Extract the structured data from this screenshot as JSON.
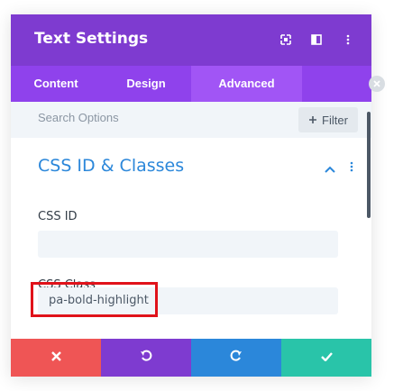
{
  "modal": {
    "title": "Text Settings",
    "header_icons": [
      "expand-icon",
      "split-view-icon",
      "more-vertical-icon"
    ]
  },
  "tabs": [
    {
      "label": "Content",
      "active": false
    },
    {
      "label": "Design",
      "active": false
    },
    {
      "label": "Advanced",
      "active": true
    }
  ],
  "search": {
    "placeholder": "Search Options",
    "filter_label": "Filter",
    "filter_icon": "plus-icon"
  },
  "section": {
    "title": "CSS ID & Classes",
    "collapse_icon": "chevron-up-icon",
    "menu_icon": "more-vertical-icon",
    "fields": [
      {
        "label": "CSS ID",
        "value": ""
      },
      {
        "label": "CSS Class",
        "value": "pa-bold-highlight"
      }
    ]
  },
  "footer": {
    "buttons": [
      {
        "name": "cancel",
        "icon": "close-icon",
        "color": "#ef5555"
      },
      {
        "name": "undo",
        "icon": "undo-icon",
        "color": "#7e3bd0"
      },
      {
        "name": "redo",
        "icon": "redo-icon",
        "color": "#2b87da"
      },
      {
        "name": "save",
        "icon": "check-icon",
        "color": "#29c4a9"
      }
    ]
  },
  "colors": {
    "header": "#7e3bd0",
    "tabs": "#8f42ec",
    "accent": "#2b87da",
    "highlight": "#e0121a"
  }
}
